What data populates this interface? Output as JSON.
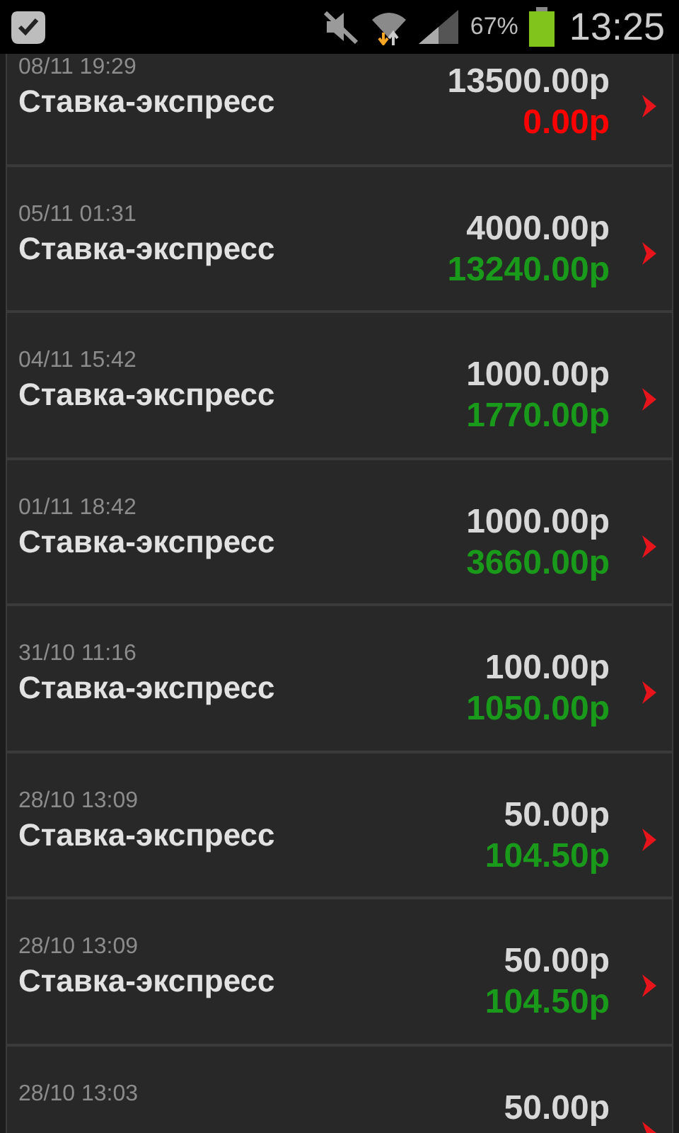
{
  "status_bar": {
    "battery_text": "67%",
    "time": "13:25"
  },
  "bets": [
    {
      "date": "08/11 19:29",
      "title": "Ставка-экспресс",
      "stake": "13500.00р",
      "result": "0.00р",
      "color": "#ff0000"
    },
    {
      "date": "05/11 01:31",
      "title": "Ставка-экспресс",
      "stake": "4000.00р",
      "result": "13240.00р",
      "color": "#1a9a1a"
    },
    {
      "date": "04/11 15:42",
      "title": "Ставка-экспресс",
      "stake": "1000.00р",
      "result": "1770.00р",
      "color": "#1a9a1a"
    },
    {
      "date": "01/11 18:42",
      "title": "Ставка-экспресс",
      "stake": "1000.00р",
      "result": "3660.00р",
      "color": "#1a9a1a"
    },
    {
      "date": "31/10 11:16",
      "title": "Ставка-экспресс",
      "stake": "100.00р",
      "result": "1050.00р",
      "color": "#1a9a1a"
    },
    {
      "date": "28/10 13:09",
      "title": "Ставка-экспресс",
      "stake": "50.00р",
      "result": "104.50р",
      "color": "#1a9a1a"
    },
    {
      "date": "28/10 13:09",
      "title": "Ставка-экспресс",
      "stake": "50.00р",
      "result": "104.50р",
      "color": "#1a9a1a"
    },
    {
      "date": "28/10 13:03",
      "stake": "50.00р"
    }
  ]
}
